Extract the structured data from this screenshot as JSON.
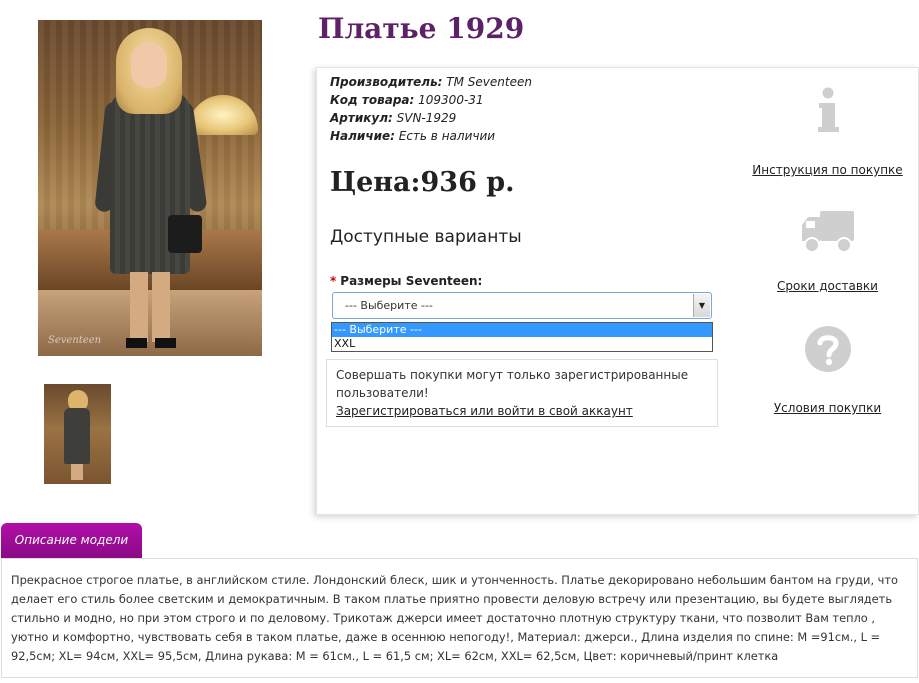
{
  "product": {
    "title": "Платье 1929",
    "manufacturer_label": "Производитель:",
    "manufacturer_value": "TM Seventeen",
    "code_label": "Код товара:",
    "code_value": "109300-31",
    "article_label": "Артикул:",
    "article_value": "SVN-1929",
    "availability_label": "Наличие:",
    "availability_value": "Есть в наличии",
    "price": "Цена:936 р."
  },
  "variants": {
    "title": "Доступные варианты",
    "required_mark": "*",
    "size_label": "Размеры Seventeen:",
    "selected": "--- Выберите ---",
    "options": [
      "--- Выберите ---",
      "XXL"
    ]
  },
  "notice": {
    "text": "Совершать покупки могут только зарегистрированные пользователи!",
    "link": "Зарегистрироваться или войти в свой аккаунт"
  },
  "side_links": [
    {
      "icon": "info-icon",
      "label": "Инструкция по покупке"
    },
    {
      "icon": "delivery-truck-icon",
      "label": "Сроки доставки"
    },
    {
      "icon": "question-icon",
      "label": "Условия покупки"
    }
  ],
  "gallery": {
    "watermark": "Seventeen"
  },
  "description": {
    "tab_label": "Описание модели",
    "text": "Прекрасное строгое платье, в английском стиле. Лондонский блеск, шик и утонченность. Платье декорировано небольшим бантом на груди, что делает его стиль более светским и демократичным. В таком платье приятно провести деловую встречу или презентацию, вы будете выглядеть стильно и модно, но при этом строго и по деловому. Трикотаж джерси имеет достаточно плотную структуру ткани, что позволит Вам тепло , уютно и комфортно, чувствовать себя в таком платье, даже в осеннюю непогоду!, Материал: джерси., Длина изделия по спине: M =91см., L = 92,5см; XL= 94см, XXL= 95,5см, Длина рукава: M = 61см., L = 61,5 см; XL= 62см, XXL= 62,5см, Цвет: коричневый/принт клетка"
  },
  "colors": {
    "title": "#5c2166",
    "tab": "#9a0c95",
    "required": "#d00000",
    "select_highlight": "#3399ff",
    "icon_gray": "#cfcfcf"
  }
}
